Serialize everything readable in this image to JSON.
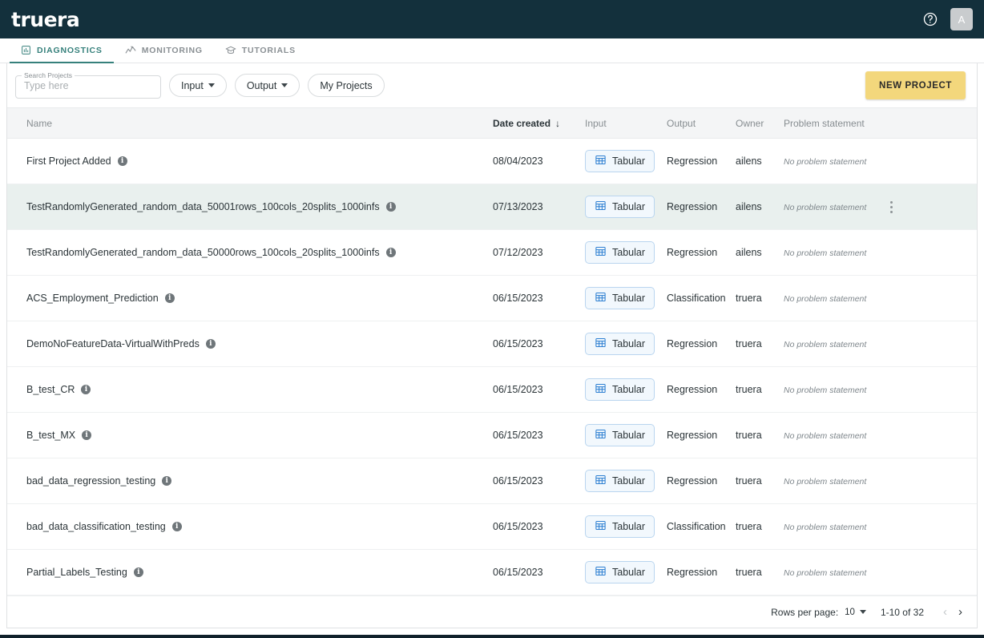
{
  "brand": {
    "logo_text": "truera"
  },
  "topbar": {
    "help_icon": "help-circle-icon",
    "avatar_initial": "A"
  },
  "nav": {
    "tabs": [
      {
        "label": "DIAGNOSTICS",
        "icon": "chart-bar-icon",
        "active": true
      },
      {
        "label": "MONITORING",
        "icon": "activity-line-icon",
        "active": false
      },
      {
        "label": "TUTORIALS",
        "icon": "graduation-cap-icon",
        "active": false
      }
    ]
  },
  "toolbar": {
    "search_label": "Search Projects",
    "search_placeholder": "Type here",
    "search_value": "",
    "filters": [
      {
        "label": "Input",
        "has_caret": true
      },
      {
        "label": "Output",
        "has_caret": true
      },
      {
        "label": "My Projects",
        "has_caret": false
      }
    ],
    "new_project_label": "NEW PROJECT"
  },
  "table": {
    "columns": {
      "name": "Name",
      "date_created": "Date created",
      "input": "Input",
      "output": "Output",
      "owner": "Owner",
      "problem_statement": "Problem statement"
    },
    "sort": {
      "column": "Date created",
      "arrow": "↓"
    },
    "rows": [
      {
        "name": "First Project Added",
        "date": "08/04/2023",
        "input": "Tabular",
        "output": "Regression",
        "owner": "ailens",
        "problem": "No problem statement",
        "hovered": false
      },
      {
        "name": "TestRandomlyGenerated_random_data_50001rows_100cols_20splits_1000infs",
        "date": "07/13/2023",
        "input": "Tabular",
        "output": "Regression",
        "owner": "ailens",
        "problem": "No problem statement",
        "hovered": true
      },
      {
        "name": "TestRandomlyGenerated_random_data_50000rows_100cols_20splits_1000infs",
        "date": "07/12/2023",
        "input": "Tabular",
        "output": "Regression",
        "owner": "ailens",
        "problem": "No problem statement",
        "hovered": false
      },
      {
        "name": "ACS_Employment_Prediction",
        "date": "06/15/2023",
        "input": "Tabular",
        "output": "Classification",
        "owner": "truera",
        "problem": "No problem statement",
        "hovered": false
      },
      {
        "name": "DemoNoFeatureData-VirtualWithPreds",
        "date": "06/15/2023",
        "input": "Tabular",
        "output": "Regression",
        "owner": "truera",
        "problem": "No problem statement",
        "hovered": false
      },
      {
        "name": "B_test_CR",
        "date": "06/15/2023",
        "input": "Tabular",
        "output": "Regression",
        "owner": "truera",
        "problem": "No problem statement",
        "hovered": false
      },
      {
        "name": "B_test_MX",
        "date": "06/15/2023",
        "input": "Tabular",
        "output": "Regression",
        "owner": "truera",
        "problem": "No problem statement",
        "hovered": false
      },
      {
        "name": "bad_data_regression_testing",
        "date": "06/15/2023",
        "input": "Tabular",
        "output": "Regression",
        "owner": "truera",
        "problem": "No problem statement",
        "hovered": false
      },
      {
        "name": "bad_data_classification_testing",
        "date": "06/15/2023",
        "input": "Tabular",
        "output": "Classification",
        "owner": "truera",
        "problem": "No problem statement",
        "hovered": false
      },
      {
        "name": "Partial_Labels_Testing",
        "date": "06/15/2023",
        "input": "Tabular",
        "output": "Regression",
        "owner": "truera",
        "problem": "No problem statement",
        "hovered": false
      }
    ]
  },
  "footer": {
    "rows_per_page_label": "Rows per page:",
    "rows_per_page_value": "10",
    "range_label": "1-10 of 32",
    "prev_arrow": "‹",
    "next_arrow": "›"
  },
  "colors": {
    "header_bg": "#13303c",
    "accent_teal": "#37817c",
    "new_project_yellow": "#f3d77c",
    "row_hover": "#e9f0ee",
    "chip_border": "#b9d5ef"
  }
}
